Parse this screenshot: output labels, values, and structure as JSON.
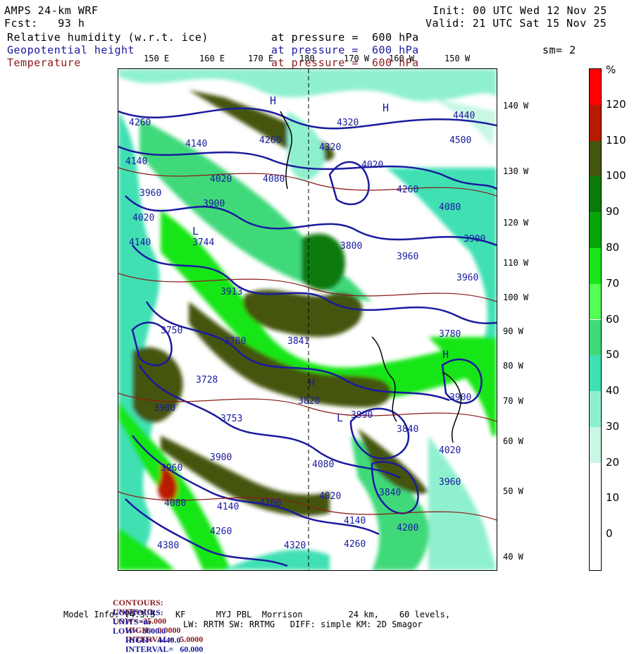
{
  "header": {
    "model": "AMPS 24-km WRF",
    "forecast": "Fcst:   93 h",
    "init": "Init: 00 UTC Wed 12 Nov 25",
    "valid": "Valid: 21 UTC Sat 15 Nov 25",
    "smoothing": "sm= 2"
  },
  "fields": [
    {
      "name": "Relative humidity (w.r.t. ice)",
      "level": "at pressure =  600 hPa",
      "color": "#000000"
    },
    {
      "name": "Geopotential height",
      "level": "at pressure =  600 hPa",
      "color": "#1a1aa0"
    },
    {
      "name": "Temperature",
      "level": "at pressure =  600 hPa",
      "color": "#8b1a1a"
    }
  ],
  "map": {
    "lon_labels": [
      "150 E",
      "160 E",
      "170 E",
      "180",
      "170 W",
      "160 W",
      "150 W"
    ],
    "lat_labels": [
      "140 W",
      "130 W",
      "120 W",
      "110 W",
      "100 W",
      "90 W",
      "80 W",
      "70 W",
      "60 W",
      "50 W",
      "40 W"
    ],
    "height_labels": [
      "4260",
      "4140",
      "4260",
      "4320",
      "4440",
      "4500",
      "4140",
      "4020",
      "4080",
      "4020",
      "4320",
      "4260",
      "4080",
      "3960",
      "3900",
      "3744",
      "3800",
      "3960",
      "4140",
      "3900",
      "3960",
      "4020",
      "3913",
      "3780",
      "3841",
      "3750",
      "3820",
      "3728",
      "3753",
      "3900",
      "3960",
      "3990",
      "3840",
      "3900",
      "4080",
      "4140",
      "4200",
      "4080",
      "4020",
      "4140",
      "4260",
      "4200",
      "4320",
      "4260",
      "4380",
      "4020",
      "3960",
      "3840",
      "3780",
      "3900"
    ],
    "pressure_centers": [
      "H",
      "L",
      "H",
      "H",
      "L",
      "H"
    ]
  },
  "legend": {
    "unit": "%",
    "levels": [
      "0",
      "10",
      "20",
      "30",
      "40",
      "50",
      "60",
      "70",
      "80",
      "90",
      "100",
      "110",
      "120"
    ],
    "colors": [
      "#ffffff",
      "#ffffff",
      "#ffffff",
      "#c8f7e4",
      "#8ff0cf",
      "#3fe0b3",
      "#40d97a",
      "#55ff55",
      "#19e619",
      "#0aa50a",
      "#0a7a0a",
      "#445510",
      "#b81a00",
      "#ff0000"
    ]
  },
  "footer": {
    "line1": {
      "label": "CONTOURS:",
      "units": "UNITS=°C",
      "low": "LOW= -35.000",
      "high": "HIGH=  0.0000",
      "interval": "INTERVAL=   5.0000"
    },
    "line2": {
      "label": "CONTOURS:",
      "units": "UNITS=m",
      "low": "LOW=  3600.0",
      "high": "HIGH=  4440.0",
      "interval": "INTERVAL=   60.000"
    },
    "model_info": "Model Info: V4.3.3    KF      MYJ PBL  Morrison         24 km,    60 levels,",
    "model_info2": "LW: RRTM SW: RRTMG   DIFF: simple KM: 2D Smagor"
  }
}
